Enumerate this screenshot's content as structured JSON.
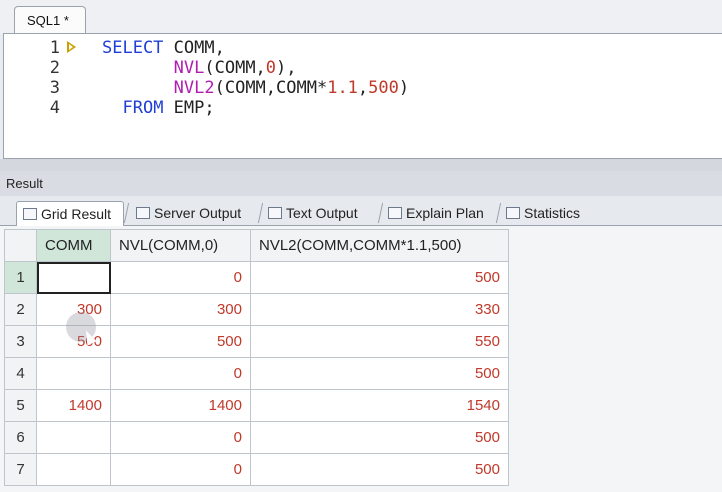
{
  "editor": {
    "tab_label": "SQL1 *",
    "lines": [
      {
        "number": "1",
        "parts": [
          {
            "cls": "kw",
            "text": "SELECT "
          },
          {
            "cls": "id",
            "text": "COMM,"
          }
        ]
      },
      {
        "number": "2",
        "parts": [
          {
            "cls": "id",
            "text": "       "
          },
          {
            "cls": "fn",
            "text": "NVL"
          },
          {
            "cls": "id",
            "text": "(COMM,"
          },
          {
            "cls": "num",
            "text": "0"
          },
          {
            "cls": "id",
            "text": "),"
          }
        ]
      },
      {
        "number": "3",
        "parts": [
          {
            "cls": "id",
            "text": "       "
          },
          {
            "cls": "fn",
            "text": "NVL2"
          },
          {
            "cls": "id",
            "text": "(COMM,COMM*"
          },
          {
            "cls": "num",
            "text": "1.1"
          },
          {
            "cls": "id",
            "text": ","
          },
          {
            "cls": "num",
            "text": "500"
          },
          {
            "cls": "id",
            "text": ")"
          }
        ]
      },
      {
        "number": "4",
        "parts": [
          {
            "cls": "id",
            "text": "  "
          },
          {
            "cls": "kw",
            "text": "FROM "
          },
          {
            "cls": "id",
            "text": "EMP;"
          }
        ]
      }
    ]
  },
  "result": {
    "title": "Result",
    "tabs": [
      "Grid Result",
      "Server Output",
      "Text Output",
      "Explain Plan",
      "Statistics"
    ],
    "active_tab": "Grid Result",
    "columns": [
      "COMM",
      "NVL(COMM,0)",
      "NVL2(COMM,COMM*1.1,500)"
    ],
    "rows": [
      {
        "num": "1",
        "cells": [
          "",
          "0",
          "500"
        ]
      },
      {
        "num": "2",
        "cells": [
          "300",
          "300",
          "330"
        ]
      },
      {
        "num": "3",
        "cells": [
          "500",
          "500",
          "550"
        ]
      },
      {
        "num": "4",
        "cells": [
          "",
          "0",
          "500"
        ]
      },
      {
        "num": "5",
        "cells": [
          "1400",
          "1400",
          "1540"
        ]
      },
      {
        "num": "6",
        "cells": [
          "",
          "0",
          "500"
        ]
      },
      {
        "num": "7",
        "cells": [
          "",
          "0",
          "500"
        ]
      }
    ]
  },
  "colors": {
    "keyword": "#1f3fd6",
    "function": "#b01eb0",
    "number": "#c0392b",
    "selected_header": "#cfe6d9"
  }
}
